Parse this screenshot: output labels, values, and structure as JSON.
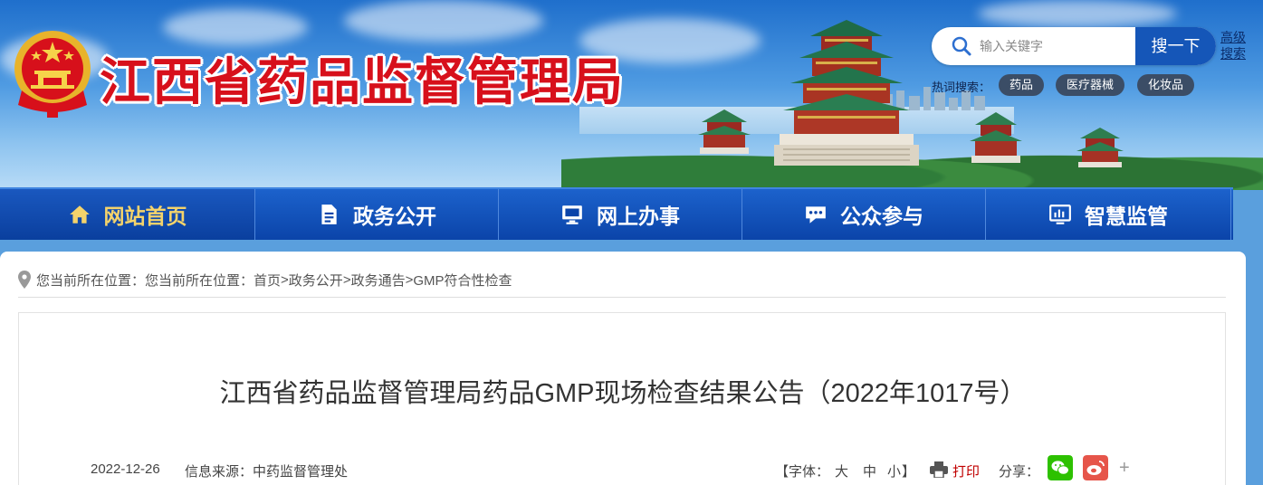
{
  "site": {
    "title": "江西省药品监督管理局"
  },
  "search": {
    "placeholder": "输入关键字",
    "button_label": "搜一下",
    "advanced_label": "高级搜索",
    "hot_label": "热词搜索：",
    "hot_tags": [
      "药品",
      "医疗器械",
      "化妆品"
    ]
  },
  "nav": {
    "items": [
      {
        "label": "网站首页",
        "icon": "home-icon",
        "active": true
      },
      {
        "label": "政务公开",
        "icon": "document-icon"
      },
      {
        "label": "网上办事",
        "icon": "monitor-icon"
      },
      {
        "label": "公众参与",
        "icon": "chat-icon"
      },
      {
        "label": "智慧监管",
        "icon": "dashboard-icon"
      }
    ]
  },
  "breadcrumb": {
    "prefix": "您当前所在位置：您当前所在位置：",
    "items": [
      "首页",
      "政务公开",
      "政务通告",
      "GMP符合性检查"
    ],
    "separator": ">"
  },
  "article": {
    "title": "江西省药品监督管理局药品GMP现场检查结果公告（2022年1017号）",
    "date": "2022-12-26",
    "source": "信息来源：中药监督管理处",
    "font_label_open": "【字体：",
    "font_large": "大",
    "font_medium": "中",
    "font_small": "小",
    "font_label_close": "】",
    "print_label": "打印",
    "share_label": "分享：",
    "share_more": "+"
  },
  "colors": {
    "title_red": "#d7101b",
    "nav_blue": "#0b44a9",
    "nav_active_text": "#f4d36b",
    "print_red": "#c00000",
    "wechat_green": "#2dc100",
    "weibo_red": "#e6554a"
  }
}
